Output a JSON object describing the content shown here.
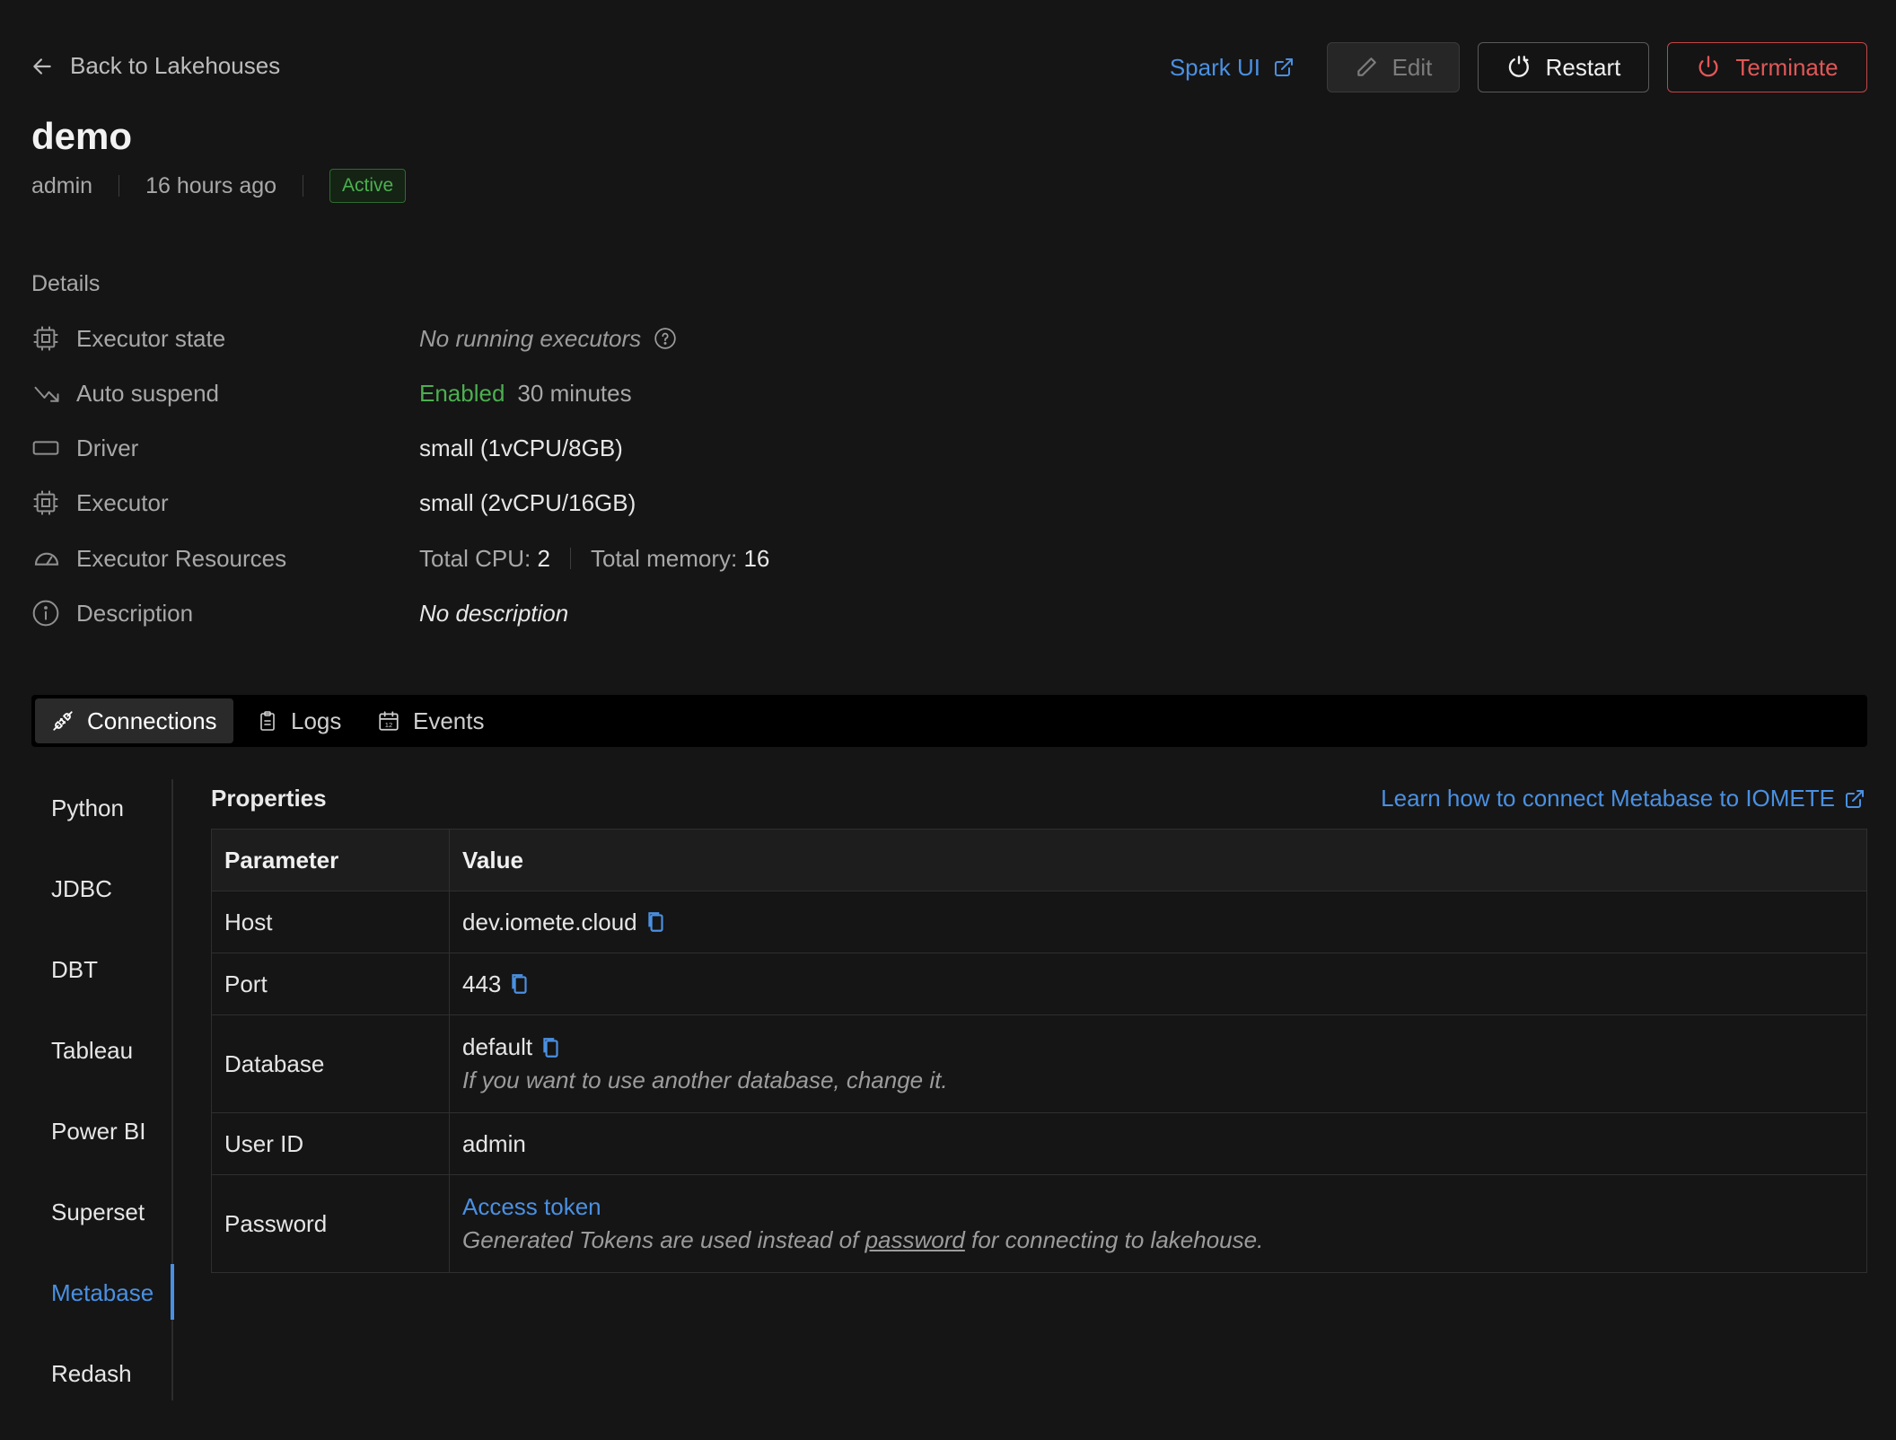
{
  "header": {
    "back_label": "Back to Lakehouses",
    "spark_ui_label": "Spark UI",
    "edit_label": "Edit",
    "restart_label": "Restart",
    "terminate_label": "Terminate"
  },
  "lakehouse": {
    "name": "demo",
    "owner": "admin",
    "created": "16 hours ago",
    "status": "Active"
  },
  "details": {
    "heading": "Details",
    "executor_state": {
      "label": "Executor state",
      "value": "No running executors"
    },
    "auto_suspend": {
      "label": "Auto suspend",
      "status": "Enabled",
      "value": "30 minutes"
    },
    "driver": {
      "label": "Driver",
      "value": "small (1vCPU/8GB)"
    },
    "executor": {
      "label": "Executor",
      "value": "small (2vCPU/16GB)"
    },
    "executor_resources": {
      "label": "Executor Resources",
      "cpu_label": "Total CPU:",
      "cpu_value": "2",
      "memory_label": "Total memory:",
      "memory_value": "16"
    },
    "description": {
      "label": "Description",
      "value": "No description"
    }
  },
  "tabs": [
    {
      "label": "Connections",
      "icon": "plug-icon",
      "active": true
    },
    {
      "label": "Logs",
      "icon": "clipboard-icon",
      "active": false
    },
    {
      "label": "Events",
      "icon": "calendar-icon",
      "active": false
    }
  ],
  "connection_nav": [
    {
      "label": "Python"
    },
    {
      "label": "JDBC"
    },
    {
      "label": "DBT"
    },
    {
      "label": "Tableau"
    },
    {
      "label": "Power BI"
    },
    {
      "label": "Superset"
    },
    {
      "label": "Metabase",
      "active": true
    },
    {
      "label": "Redash"
    }
  ],
  "properties": {
    "heading": "Properties",
    "learn_link": "Learn how to connect Metabase to IOMETE",
    "columns": [
      "Parameter",
      "Value"
    ],
    "rows": {
      "host": {
        "param": "Host",
        "value": "dev.iomete.cloud"
      },
      "port": {
        "param": "Port",
        "value": "443"
      },
      "database": {
        "param": "Database",
        "value": "default",
        "note": "If you want to use another database, change it."
      },
      "user_id": {
        "param": "User ID",
        "value": "admin"
      },
      "password": {
        "param": "Password",
        "value": "Access token",
        "note_before": "Generated Tokens are used instead of",
        "note_link": "password",
        "note_after": "for connecting to lakehouse."
      }
    }
  },
  "colors": {
    "background": "#151515",
    "accent": "#4a90e2",
    "success": "#4caf50",
    "danger": "#e05757"
  }
}
